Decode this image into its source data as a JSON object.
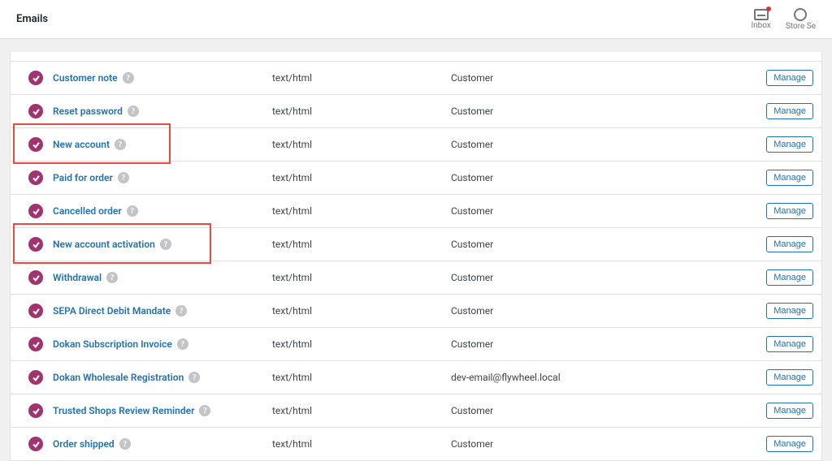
{
  "header": {
    "title": "Emails",
    "inbox_label": "Inbox",
    "store_label": "Store Se"
  },
  "manage_label": "Manage",
  "rows": [
    {
      "name": "Customer note",
      "type": "text/html",
      "recipient": "Customer"
    },
    {
      "name": "Reset password",
      "type": "text/html",
      "recipient": "Customer"
    },
    {
      "name": "New account",
      "type": "text/html",
      "recipient": "Customer",
      "highlight": true
    },
    {
      "name": "Paid for order",
      "type": "text/html",
      "recipient": "Customer"
    },
    {
      "name": "Cancelled order",
      "type": "text/html",
      "recipient": "Customer"
    },
    {
      "name": "New account activation",
      "type": "text/html",
      "recipient": "Customer",
      "highlight": true,
      "highlight_wide": true
    },
    {
      "name": "Withdrawal",
      "type": "text/html",
      "recipient": "Customer"
    },
    {
      "name": "SEPA Direct Debit Mandate",
      "type": "text/html",
      "recipient": "Customer"
    },
    {
      "name": "Dokan Subscription Invoice",
      "type": "text/html",
      "recipient": "Customer"
    },
    {
      "name": "Dokan Wholesale Registration",
      "type": "text/html",
      "recipient": "dev-email@flywheel.local"
    },
    {
      "name": "Trusted Shops Review Reminder",
      "type": "text/html",
      "recipient": "Customer"
    },
    {
      "name": "Order shipped",
      "type": "text/html",
      "recipient": "Customer"
    }
  ]
}
